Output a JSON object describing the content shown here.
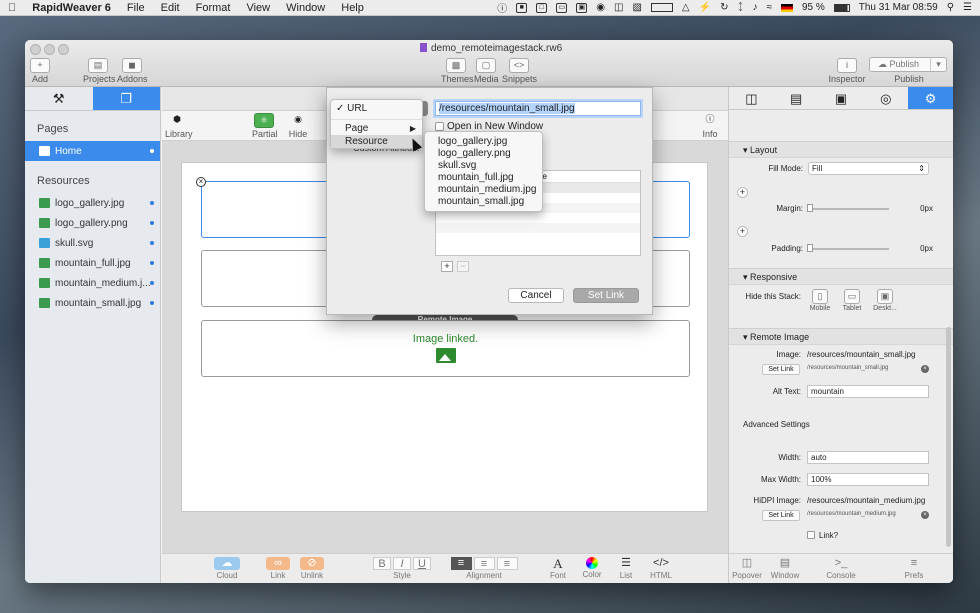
{
  "menubar": {
    "app": "RapidWeaver 6",
    "items": [
      "File",
      "Edit",
      "Format",
      "View",
      "Window",
      "Help"
    ],
    "battery": "95 %",
    "datetime": "Thu 31 Mar  08:59"
  },
  "window": {
    "title": "demo_remoteimagestack.rw6"
  },
  "toolbar": {
    "add": "Add",
    "projects": "Projects",
    "addons": "Addons",
    "themes": "Themes",
    "media": "Media",
    "snippets": "Snippets",
    "inspector": "Inspector",
    "publish_btn": "Publish",
    "publish": "Publish"
  },
  "sidebar": {
    "pages_header": "Pages",
    "home": "Home",
    "resources_header": "Resources",
    "resources": [
      "logo_gallery.jpg",
      "logo_gallery.png",
      "skull.svg",
      "mountain_full.jpg",
      "mountain_medium.j...",
      "mountain_small.jpg"
    ]
  },
  "edit_toolbar": {
    "library": "Library",
    "partial": "Partial",
    "hide": "Hide",
    "info": "Info"
  },
  "canvas": {
    "stack_label": "Remote Image",
    "image_linked": "Image linked."
  },
  "link_dialog": {
    "url_field": "/resources/mountain_small.jpg",
    "open_new_window": "Open in New Window",
    "custom_attr_partial": "Custom Attribu...",
    "table_header": "ue",
    "cancel": "Cancel",
    "set_link": "Set Link",
    "type_menu": [
      "URL",
      "Page",
      "Resource"
    ],
    "resource_submenu": [
      "logo_gallery.jpg",
      "logo_gallery.png",
      "skull.svg",
      "mountain_full.jpg",
      "mountain_medium.jpg",
      "mountain_small.jpg"
    ]
  },
  "bottombar": {
    "cloud": "Cloud",
    "link": "Link",
    "unlink": "Unlink",
    "style": "Style",
    "alignment": "Alignment",
    "font": "Font",
    "color": "Color",
    "list": "List",
    "html": "HTML"
  },
  "inspector": {
    "layout": "Layout",
    "fill_mode_label": "Fill Mode:",
    "fill_mode": "Fill",
    "margin_label": "Margin:",
    "margin": "0px",
    "padding_label": "Padding:",
    "padding": "0px",
    "responsive": "Responsive",
    "hide_stack_label": "Hide this Stack:",
    "mobile": "Mobile",
    "tablet": "Tablet",
    "desktop": "Deskt...",
    "remote_image": "Remote Image",
    "image_label": "Image:",
    "image_value": "/resources/mountain_small.jpg",
    "set_link": "Set Link",
    "image_link_small": "/resources/mountain_small.jpg",
    "alt_label": "Alt Text:",
    "alt_value": "mountain",
    "advanced": "Advanced Settings",
    "width_label": "Width:",
    "width": "auto",
    "maxwidth_label": "Max Width:",
    "maxwidth": "100%",
    "hidpi_label": "HiDPI Image:",
    "hidpi_value": "/resources/mountain_medium.jpg",
    "hidpi_link_small": "/resources/mountain_medium.jpg",
    "link_check": "Link?",
    "footer": {
      "popover": "Popover",
      "window": "Window",
      "console": "Console",
      "prefs": "Prefs"
    }
  }
}
